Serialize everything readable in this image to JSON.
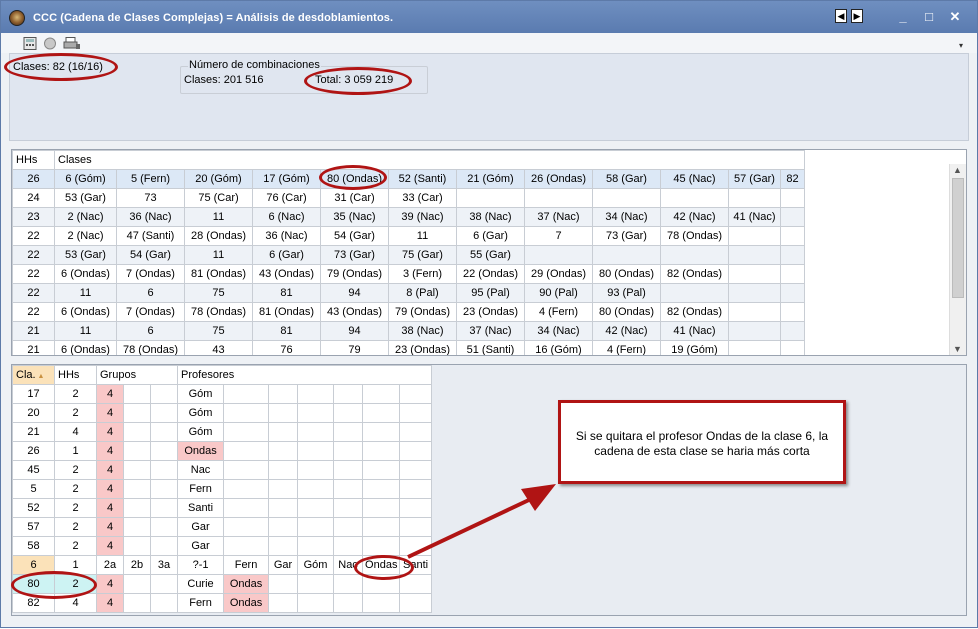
{
  "window": {
    "title": "CCC (Cadena de Clases Complejas) = Análisis de desdoblamientos.",
    "nav_prev": "◀",
    "nav_next": "▶",
    "btn_min": "_",
    "btn_max": "□",
    "btn_close": "✕"
  },
  "summary": {
    "clases_label": "Clases: 82 (16/16)",
    "combinaciones_title": "Número de combinaciones",
    "combinaciones_clases": "Clases: 201 516",
    "combinaciones_total": "Total: 3 059 219"
  },
  "top_grid": {
    "headers": [
      "HHs",
      "Clases"
    ],
    "rows": [
      [
        "26",
        "6 (Góm)",
        "5 (Fern)",
        "20 (Góm)",
        "17 (Góm)",
        "80 (Ondas)",
        "52 (Santi)",
        "21 (Góm)",
        "26 (Ondas)",
        "58 (Gar)",
        "45 (Nac)",
        "57 (Gar)",
        "82"
      ],
      [
        "24",
        "53 (Gar)",
        "73",
        "75 (Car)",
        "76 (Car)",
        "31 (Car)",
        "33 (Car)",
        "",
        "",
        "",
        "",
        "",
        ""
      ],
      [
        "23",
        "2 (Nac)",
        "36 (Nac)",
        "11",
        "6 (Nac)",
        "35 (Nac)",
        "39 (Nac)",
        "38 (Nac)",
        "37 (Nac)",
        "34 (Nac)",
        "42 (Nac)",
        "41 (Nac)",
        ""
      ],
      [
        "22",
        "2 (Nac)",
        "47 (Santi)",
        "28 (Ondas)",
        "36 (Nac)",
        "54 (Gar)",
        "11",
        "6 (Gar)",
        "7",
        "73 (Gar)",
        "78 (Ondas)",
        "",
        ""
      ],
      [
        "22",
        "53 (Gar)",
        "54 (Gar)",
        "11",
        "6 (Gar)",
        "73 (Gar)",
        "75 (Gar)",
        "55 (Gar)",
        "",
        "",
        "",
        "",
        ""
      ],
      [
        "22",
        "6 (Ondas)",
        "7 (Ondas)",
        "81 (Ondas)",
        "43 (Ondas)",
        "79 (Ondas)",
        "3 (Fern)",
        "22 (Ondas)",
        "29 (Ondas)",
        "80 (Ondas)",
        "82 (Ondas)",
        "",
        ""
      ],
      [
        "22",
        "11",
        "6",
        "75",
        "81",
        "94",
        "8 (Pal)",
        "95 (Pal)",
        "90 (Pal)",
        "93 (Pal)",
        "",
        "",
        ""
      ],
      [
        "22",
        "6 (Ondas)",
        "7 (Ondas)",
        "78 (Ondas)",
        "81 (Ondas)",
        "43 (Ondas)",
        "79 (Ondas)",
        "23 (Ondas)",
        "4 (Fern)",
        "80 (Ondas)",
        "82 (Ondas)",
        "",
        ""
      ],
      [
        "21",
        "11",
        "6",
        "75",
        "81",
        "94",
        "38 (Nac)",
        "37 (Nac)",
        "34 (Nac)",
        "42 (Nac)",
        "41 (Nac)",
        "",
        ""
      ],
      [
        "21",
        "6 (Ondas)",
        "78 (Ondas)",
        "43",
        "76",
        "79",
        "23 (Ondas)",
        "51 (Santi)",
        "16 (Góm)",
        "4 (Fern)",
        "19 (Góm)",
        "",
        ""
      ]
    ]
  },
  "bottom_grid": {
    "headers": [
      "Cla.",
      "HHs",
      "Grupos",
      "Profesores"
    ],
    "rows": [
      [
        "17",
        "2",
        "4",
        "",
        "",
        "Góm"
      ],
      [
        "20",
        "2",
        "4",
        "",
        "",
        "Góm"
      ],
      [
        "21",
        "4",
        "4",
        "",
        "",
        "Góm"
      ],
      [
        "26",
        "1",
        "4",
        "",
        "",
        "Ondas"
      ],
      [
        "45",
        "2",
        "4",
        "",
        "",
        "Nac"
      ],
      [
        "5",
        "2",
        "4",
        "",
        "",
        "Fern"
      ],
      [
        "52",
        "2",
        "4",
        "",
        "",
        "Santi"
      ],
      [
        "57",
        "2",
        "4",
        "",
        "",
        "Gar"
      ],
      [
        "58",
        "2",
        "4",
        "",
        "",
        "Gar"
      ]
    ],
    "header_row2": [
      "6",
      "1",
      "2a",
      "2b",
      "3a",
      "?-1",
      "Fern",
      "Gar",
      "Góm",
      "Nac",
      "Ondas",
      "Santi"
    ],
    "rows2": [
      [
        "80",
        "2",
        "4",
        "",
        "",
        "Curie",
        "Ondas"
      ],
      [
        "82",
        "4",
        "4",
        "",
        "",
        "Fern",
        "Ondas"
      ]
    ]
  },
  "callout": {
    "text": "Si se quitara el profesor Ondas de la clase 6, la cadena de esta clase se haria más corta"
  },
  "colors": {
    "annotation_red": "#b01414",
    "pink_cell": "#f9c8c8",
    "titlebar_blue": "#5a7bb0"
  }
}
